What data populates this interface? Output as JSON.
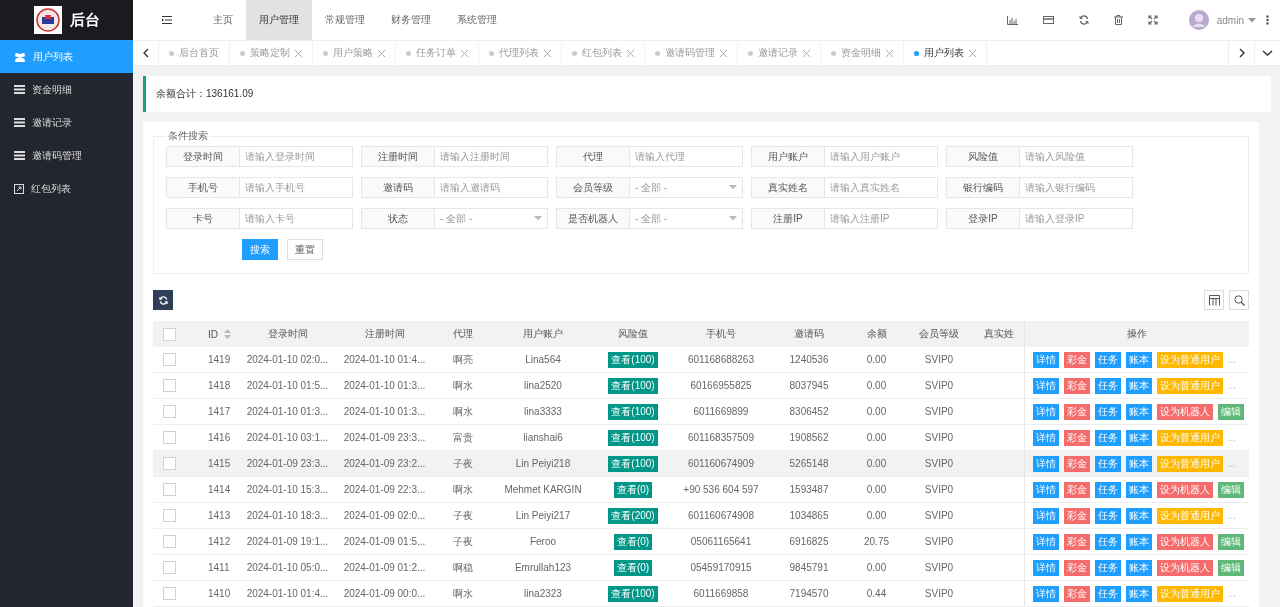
{
  "header": {
    "logo_text": "后台",
    "nav": [
      {
        "label": "主页",
        "selected": false
      },
      {
        "label": "用户管理",
        "selected": true
      },
      {
        "label": "常规管理",
        "selected": false
      },
      {
        "label": "财务管理",
        "selected": false
      },
      {
        "label": "系统管理",
        "selected": false
      }
    ],
    "user": "admin"
  },
  "sidebar": {
    "items": [
      {
        "label": "用户列表",
        "selected": true,
        "kind": "users"
      },
      {
        "label": "资金明细",
        "selected": false,
        "kind": "list"
      },
      {
        "label": "邀请记录",
        "selected": false,
        "kind": "list"
      },
      {
        "label": "邀请码管理",
        "selected": false,
        "kind": "list"
      },
      {
        "label": "红包列表",
        "selected": false,
        "kind": "link"
      }
    ]
  },
  "tabs": [
    {
      "label": "后台首页",
      "selected": false,
      "closable": false
    },
    {
      "label": "策略定制",
      "selected": false,
      "closable": true
    },
    {
      "label": "用户策略",
      "selected": false,
      "closable": true
    },
    {
      "label": "任务订单",
      "selected": false,
      "closable": true
    },
    {
      "label": "代理列表",
      "selected": false,
      "closable": true
    },
    {
      "label": "红包列表",
      "selected": false,
      "closable": true
    },
    {
      "label": "邀请码管理",
      "selected": false,
      "closable": true
    },
    {
      "label": "邀请记录",
      "selected": false,
      "closable": true
    },
    {
      "label": "资金明细",
      "selected": false,
      "closable": true
    },
    {
      "label": "用户列表",
      "selected": true,
      "closable": true
    }
  ],
  "summary": {
    "label": "余额合计：",
    "value": "136161.09"
  },
  "search": {
    "legend": "条件搜索",
    "fields": [
      {
        "label": "登录时间",
        "kind": "input",
        "placeholder": "请输入登录时间"
      },
      {
        "label": "注册时间",
        "kind": "input",
        "placeholder": "请输入注册时间"
      },
      {
        "label": "代理",
        "kind": "input",
        "placeholder": "请输入代理"
      },
      {
        "label": "用户账户",
        "kind": "input",
        "placeholder": "请输入用户账户"
      },
      {
        "label": "风险值",
        "kind": "input",
        "placeholder": "请输入风险值"
      },
      {
        "label": "手机号",
        "kind": "input",
        "placeholder": "请输入手机号"
      },
      {
        "label": "邀请码",
        "kind": "input",
        "placeholder": "请输入邀请码"
      },
      {
        "label": "会员等级",
        "kind": "select",
        "placeholder": "- 全部 -"
      },
      {
        "label": "真实姓名",
        "kind": "input",
        "placeholder": "请输入真实姓名"
      },
      {
        "label": "银行编码",
        "kind": "input",
        "placeholder": "请输入银行编码"
      },
      {
        "label": "卡号",
        "kind": "input",
        "placeholder": "请输入卡号"
      },
      {
        "label": "状态",
        "kind": "select",
        "placeholder": "- 全部 -"
      },
      {
        "label": "是否机器人",
        "kind": "select",
        "placeholder": "- 全部 -"
      },
      {
        "label": "注册IP",
        "kind": "input",
        "placeholder": "请输入注册IP"
      },
      {
        "label": "登录IP",
        "kind": "input",
        "placeholder": "请输入登录IP"
      }
    ],
    "buttons": [
      {
        "label": "搜索",
        "kind": "primary"
      },
      {
        "label": "重置",
        "kind": "plain"
      }
    ]
  },
  "table": {
    "all_selected": false,
    "columns": [
      {
        "label": "ID",
        "sortable": true
      },
      {
        "label": "登录时间",
        "sortable": false
      },
      {
        "label": "注册时间",
        "sortable": false
      },
      {
        "label": "代理",
        "sortable": false
      },
      {
        "label": "用户账户",
        "sortable": false
      },
      {
        "label": "风险值",
        "sortable": false
      },
      {
        "label": "手机号",
        "sortable": false
      },
      {
        "label": "邀请码",
        "sortable": false
      },
      {
        "label": "余额",
        "sortable": false
      },
      {
        "label": "会员等级",
        "sortable": false
      },
      {
        "label": "真实姓",
        "sortable": false
      }
    ],
    "actions_column": "操作",
    "rows": [
      {
        "selected": false,
        "highlighted": false,
        "id": "1419",
        "login_time": "2024-01-10 02:0...",
        "reg_time": "2024-01-10 01:4...",
        "agent": "啊亮",
        "account": "Lina564",
        "risk": "查看(100)",
        "phone": "601168688263",
        "invite_code": "1240536",
        "balance": "0.00",
        "level": "SVIP0",
        "actions": [
          {
            "label": "详情",
            "kind": "primary"
          },
          {
            "label": "彩金",
            "kind": "danger"
          },
          {
            "label": "任务",
            "kind": "primary"
          },
          {
            "label": "账本",
            "kind": "primary"
          },
          {
            "label": "设为普通用户",
            "kind": "warning"
          },
          {
            "label": "...",
            "kind": "more"
          }
        ]
      },
      {
        "selected": false,
        "highlighted": false,
        "id": "1418",
        "login_time": "2024-01-10 01:5...",
        "reg_time": "2024-01-10 01:3...",
        "agent": "啊水",
        "account": "lina2520",
        "risk": "查看(100)",
        "phone": "60166955825",
        "invite_code": "8037945",
        "balance": "0.00",
        "level": "SVIP0",
        "actions": [
          {
            "label": "详情",
            "kind": "primary"
          },
          {
            "label": "彩金",
            "kind": "danger"
          },
          {
            "label": "任务",
            "kind": "primary"
          },
          {
            "label": "账本",
            "kind": "primary"
          },
          {
            "label": "设为普通用户",
            "kind": "warning"
          },
          {
            "label": "...",
            "kind": "more"
          }
        ]
      },
      {
        "selected": false,
        "highlighted": false,
        "id": "1417",
        "login_time": "2024-01-10 01:3...",
        "reg_time": "2024-01-10 01:3...",
        "agent": "啊水",
        "account": "lina3333",
        "risk": "查看(100)",
        "phone": "6011669899",
        "invite_code": "8306452",
        "balance": "0.00",
        "level": "SVIP0",
        "actions": [
          {
            "label": "详情",
            "kind": "primary"
          },
          {
            "label": "彩金",
            "kind": "danger"
          },
          {
            "label": "任务",
            "kind": "primary"
          },
          {
            "label": "账本",
            "kind": "primary"
          },
          {
            "label": "设为机器人",
            "kind": "danger"
          },
          {
            "label": "编辑",
            "kind": "success"
          }
        ]
      },
      {
        "selected": false,
        "highlighted": false,
        "id": "1416",
        "login_time": "2024-01-10 03:1...",
        "reg_time": "2024-01-09 23:3...",
        "agent": "富贵",
        "account": "lianshai6",
        "risk": "查看(100)",
        "phone": "601168357509",
        "invite_code": "1908562",
        "balance": "0.00",
        "level": "SVIP0",
        "actions": [
          {
            "label": "详情",
            "kind": "primary"
          },
          {
            "label": "彩金",
            "kind": "danger"
          },
          {
            "label": "任务",
            "kind": "primary"
          },
          {
            "label": "账本",
            "kind": "primary"
          },
          {
            "label": "设为普通用户",
            "kind": "warning"
          },
          {
            "label": "...",
            "kind": "more"
          }
        ]
      },
      {
        "selected": false,
        "highlighted": true,
        "id": "1415",
        "login_time": "2024-01-09 23:3...",
        "reg_time": "2024-01-09 23:2...",
        "agent": "子夜",
        "account": "Lin Peiyi218",
        "risk": "查看(100)",
        "phone": "601160674909",
        "invite_code": "5265148",
        "balance": "0.00",
        "level": "SVIP0",
        "actions": [
          {
            "label": "详情",
            "kind": "primary"
          },
          {
            "label": "彩金",
            "kind": "danger"
          },
          {
            "label": "任务",
            "kind": "primary"
          },
          {
            "label": "账本",
            "kind": "primary"
          },
          {
            "label": "设为普通用户",
            "kind": "warning"
          },
          {
            "label": "...",
            "kind": "more"
          }
        ]
      },
      {
        "selected": false,
        "highlighted": false,
        "id": "1414",
        "login_time": "2024-01-10 15:3...",
        "reg_time": "2024-01-09 22:3...",
        "agent": "啊水",
        "account": "Mehmet KARGIN",
        "risk": "查看(0)",
        "phone": "+90 536 604 597",
        "invite_code": "1593487",
        "balance": "0.00",
        "level": "SVIP0",
        "actions": [
          {
            "label": "详情",
            "kind": "primary"
          },
          {
            "label": "彩金",
            "kind": "danger"
          },
          {
            "label": "任务",
            "kind": "primary"
          },
          {
            "label": "账本",
            "kind": "primary"
          },
          {
            "label": "设为机器人",
            "kind": "danger"
          },
          {
            "label": "编辑",
            "kind": "success"
          }
        ]
      },
      {
        "selected": false,
        "highlighted": false,
        "id": "1413",
        "login_time": "2024-01-10 18:3...",
        "reg_time": "2024-01-09 02:0...",
        "agent": "子夜",
        "account": "Lin Peiyi217",
        "risk": "查看(200)",
        "phone": "601160674908",
        "invite_code": "1034865",
        "balance": "0.00",
        "level": "SVIP0",
        "actions": [
          {
            "label": "详情",
            "kind": "primary"
          },
          {
            "label": "彩金",
            "kind": "danger"
          },
          {
            "label": "任务",
            "kind": "primary"
          },
          {
            "label": "账本",
            "kind": "primary"
          },
          {
            "label": "设为普通用户",
            "kind": "warning"
          },
          {
            "label": "...",
            "kind": "more"
          }
        ]
      },
      {
        "selected": false,
        "highlighted": false,
        "id": "1412",
        "login_time": "2024-01-09 19:1...",
        "reg_time": "2024-01-09 01:5...",
        "agent": "子夜",
        "account": "Feroo",
        "risk": "查看(0)",
        "phone": "05061165641",
        "invite_code": "6916825",
        "balance": "20.75",
        "level": "SVIP0",
        "actions": [
          {
            "label": "详情",
            "kind": "primary"
          },
          {
            "label": "彩金",
            "kind": "danger"
          },
          {
            "label": "任务",
            "kind": "primary"
          },
          {
            "label": "账本",
            "kind": "primary"
          },
          {
            "label": "设为机器人",
            "kind": "danger"
          },
          {
            "label": "编辑",
            "kind": "success"
          }
        ]
      },
      {
        "selected": false,
        "highlighted": false,
        "id": "1411",
        "login_time": "2024-01-10 05:0...",
        "reg_time": "2024-01-09 01:2...",
        "agent": "啊稳",
        "account": "Emrullah123",
        "risk": "查看(0)",
        "phone": "05459170915",
        "invite_code": "9845791",
        "balance": "0.00",
        "level": "SVIP0",
        "actions": [
          {
            "label": "详情",
            "kind": "primary"
          },
          {
            "label": "彩金",
            "kind": "danger"
          },
          {
            "label": "任务",
            "kind": "primary"
          },
          {
            "label": "账本",
            "kind": "primary"
          },
          {
            "label": "设为机器人",
            "kind": "danger"
          },
          {
            "label": "编辑",
            "kind": "success"
          }
        ]
      },
      {
        "selected": false,
        "highlighted": false,
        "id": "1410",
        "login_time": "2024-01-10 01:4...",
        "reg_time": "2024-01-09 00:0...",
        "agent": "啊水",
        "account": "lina2323",
        "risk": "查看(100)",
        "phone": "6011669858",
        "invite_code": "7194570",
        "balance": "0.44",
        "level": "SVIP0",
        "actions": [
          {
            "label": "详情",
            "kind": "primary"
          },
          {
            "label": "彩金",
            "kind": "danger"
          },
          {
            "label": "任务",
            "kind": "primary"
          },
          {
            "label": "账本",
            "kind": "primary"
          },
          {
            "label": "设为普通用户",
            "kind": "warning"
          },
          {
            "label": "...",
            "kind": "more"
          }
        ]
      }
    ]
  }
}
